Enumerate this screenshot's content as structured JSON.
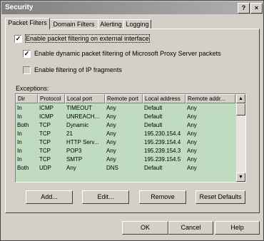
{
  "window": {
    "title": "Security",
    "help_label": "?",
    "close_label": "×"
  },
  "tabs": [
    {
      "label": "Packet Filters"
    },
    {
      "label": "Domain Filters"
    },
    {
      "label": "Alerting"
    },
    {
      "label": "Logging"
    }
  ],
  "options": {
    "enable_packet_filtering": {
      "label": "Enable packet filtering on external interface",
      "checked": true,
      "mark": "✓"
    },
    "enable_dynamic": {
      "label": "Enable dynamic packet filtering of Microsoft Proxy Server packets",
      "checked": true,
      "mark": "✓"
    },
    "enable_ip_fragments": {
      "label": "Enable filtering of IP fragments",
      "checked": false,
      "mark": ""
    }
  },
  "exceptions": {
    "label": "Exceptions:",
    "columns": [
      "Dir",
      "Protocol",
      "Local port",
      "Remote port",
      "Local address",
      "Remote addr..."
    ],
    "rows": [
      [
        "In",
        "ICMP",
        "TIMEOUT",
        "Any",
        "Default",
        "Any"
      ],
      [
        "In",
        "ICMP",
        "UNREACH...",
        "Any",
        "Default",
        "Any"
      ],
      [
        "Both",
        "TCP",
        "Dynamic",
        "Any",
        "Default",
        "Any"
      ],
      [
        "In",
        "TCP",
        "21",
        "Any",
        "195.230.154.4",
        "Any"
      ],
      [
        "In",
        "TCP",
        "HTTP Serv...",
        "Any",
        "195.239.154.4",
        "Any"
      ],
      [
        "In",
        "TCP",
        "POP3",
        "Any",
        "195.239.154.3",
        "Any"
      ],
      [
        "In",
        "TCP",
        "SMTP",
        "Any",
        "195.239.154.5",
        "Any"
      ],
      [
        "Both",
        "UDP",
        "Any",
        "DNS",
        "Default",
        "Any"
      ]
    ]
  },
  "buttons": {
    "add": "Add...",
    "edit": "Edit...",
    "remove": "Remove",
    "reset": "Reset Defaults"
  },
  "footer": {
    "ok": "OK",
    "cancel": "Cancel",
    "help": "Help"
  },
  "colors": {
    "list_background": "#c0dcc0",
    "title_gradient": "#808080"
  }
}
